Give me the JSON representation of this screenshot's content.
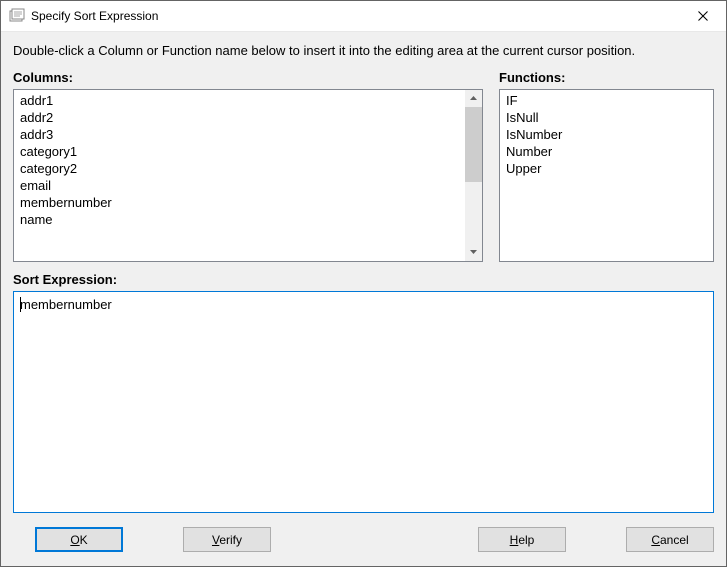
{
  "window": {
    "title": "Specify Sort Expression"
  },
  "instructions": "Double-click a Column or Function name below to insert it into the editing area at the current cursor position.",
  "columns": {
    "label": "Columns:",
    "items": [
      "addr1",
      "addr2",
      "addr3",
      "category1",
      "category2",
      "email",
      "membernumber",
      "name"
    ]
  },
  "functions": {
    "label": "Functions:",
    "items": [
      "IF",
      "IsNull",
      "IsNumber",
      "Number",
      "Upper"
    ]
  },
  "expr": {
    "label": "Sort Expression:",
    "value": "membernumber"
  },
  "buttons": {
    "ok_pre": "",
    "ok_u": "O",
    "ok_post": "K",
    "verify_pre": "",
    "verify_u": "V",
    "verify_post": "erify",
    "help_pre": "",
    "help_u": "H",
    "help_post": "elp",
    "cancel_pre": "",
    "cancel_u": "C",
    "cancel_post": "ancel"
  }
}
